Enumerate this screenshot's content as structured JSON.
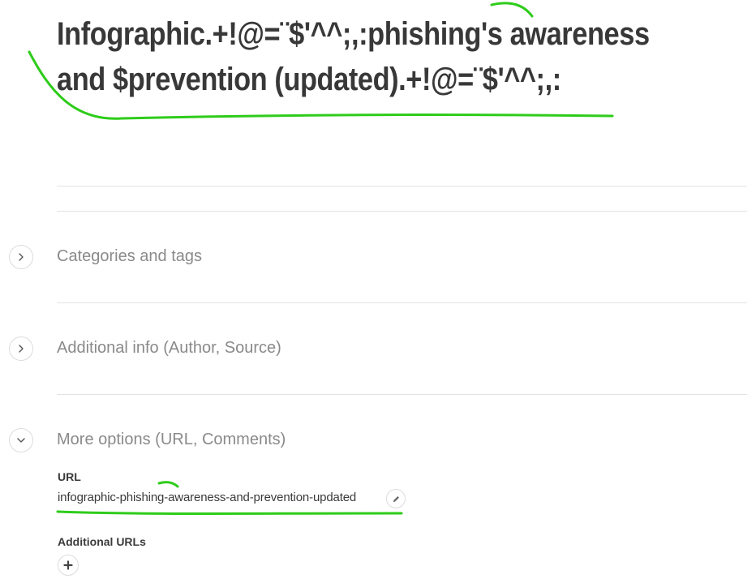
{
  "title": "Infographic.+!@=¨$'^^;,:phishing's awareness and $prevention (updated).+!@=¨$'^^;,:",
  "sections": [
    {
      "label": "Categories and tags",
      "expanded": false,
      "icon": "chevron-right-icon"
    },
    {
      "label": "Additional info (Author, Source)",
      "expanded": false,
      "icon": "chevron-right-icon"
    },
    {
      "label": "More options (URL, Comments)",
      "expanded": true,
      "icon": "chevron-down-icon"
    }
  ],
  "more_options": {
    "url_label": "URL",
    "url_value": "infographic-phishing-awareness-and-prevention-updated",
    "url_edit_icon": "pencil-icon",
    "additional_urls_label": "Additional URLs",
    "add_url_icon": "plus-icon"
  },
  "colors": {
    "annotation_stroke": "#2ecc1a",
    "divider": "#e3e3e3",
    "section_label": "#8a8a8a",
    "text": "#3a3a3a"
  }
}
